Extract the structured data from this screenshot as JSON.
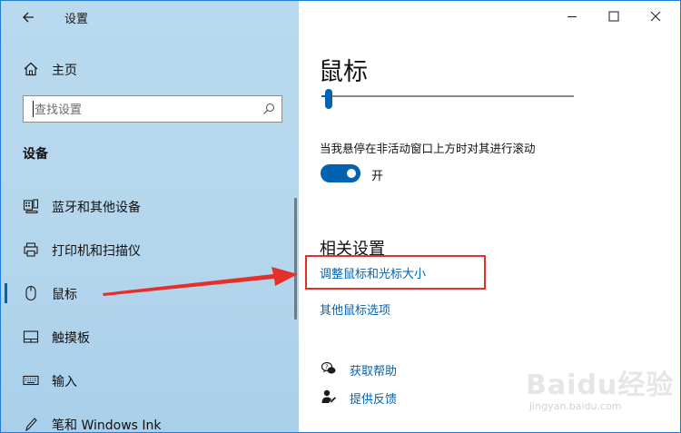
{
  "window": {
    "title": "设置",
    "accent_color": "#0063b1",
    "minimize_icon": "minimize-icon",
    "maximize_icon": "maximize-icon",
    "close_icon": "close-icon"
  },
  "sidebar": {
    "home_label": "主页",
    "search_placeholder": "查找设置",
    "section_heading": "设备",
    "items": [
      {
        "label": "蓝牙和其他设备",
        "icon": "bluetooth-devices-icon",
        "active": false
      },
      {
        "label": "打印机和扫描仪",
        "icon": "printer-icon",
        "active": false
      },
      {
        "label": "鼠标",
        "icon": "mouse-icon",
        "active": true
      },
      {
        "label": "触摸板",
        "icon": "touchpad-icon",
        "active": false
      },
      {
        "label": "输入",
        "icon": "keyboard-icon",
        "active": false
      },
      {
        "label": "笔和 Windows Ink",
        "icon": "pen-icon",
        "active": false
      }
    ]
  },
  "main": {
    "page_title": "鼠标",
    "slider_value_fraction": 0.03,
    "scroll_inactive_label": "当我悬停在非活动窗口上方时对其进行滚动",
    "scroll_inactive_toggle": {
      "on": true,
      "state_label": "开"
    },
    "related_heading": "相关设置",
    "related_links": [
      "调整鼠标和光标大小",
      "其他鼠标选项"
    ],
    "help_links": [
      {
        "label": "获取帮助",
        "icon": "help-chat-icon"
      },
      {
        "label": "提供反馈",
        "icon": "feedback-icon"
      }
    ]
  },
  "annotation": {
    "highlight_color": "#e4302b"
  },
  "watermark": {
    "main": "Baidu经验",
    "sub": "jingyan.baidu.com"
  }
}
